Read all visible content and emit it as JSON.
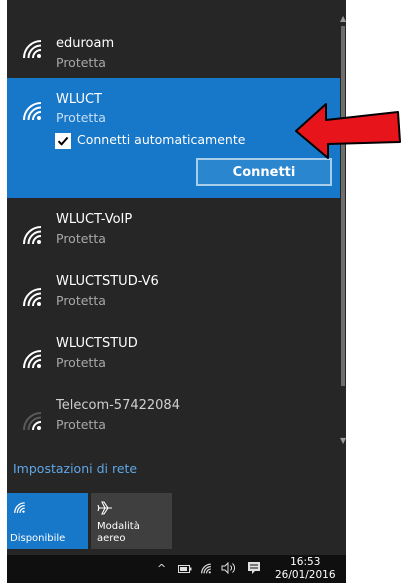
{
  "networks": [
    {
      "name": "eduroam",
      "status": "Protetta"
    },
    {
      "name": "WLUCT",
      "status": "Protetta"
    },
    {
      "name": "WLUCT-VoIP",
      "status": "Protetta"
    },
    {
      "name": "WLUCTSTUD-V6",
      "status": "Protetta"
    },
    {
      "name": "WLUCTSTUD",
      "status": "Protetta"
    },
    {
      "name": "Telecom-57422084",
      "status": "Protetta"
    }
  ],
  "selected": {
    "auto_connect_label": "Connetti automaticamente",
    "auto_connect_checked": true,
    "connect_label": "Connetti"
  },
  "settings_link": "Impostazioni di rete",
  "tiles": [
    {
      "label": "Disponibile",
      "icon": "wifi-icon",
      "active": true
    },
    {
      "label_line1": "Modalità",
      "label_line2": "aereo",
      "icon": "airplane-icon",
      "active": false
    }
  ],
  "taskbar": {
    "time": "16:53",
    "date": "26/01/2016",
    "icons": [
      "chevron-up-icon",
      "battery-icon",
      "wifi-icon",
      "volume-icon",
      "notification-icon"
    ]
  },
  "colors": {
    "flyout_bg": "#262626",
    "accent": "#1777c9",
    "link": "#5fa7e6",
    "annotation_arrow": "#e8141b"
  }
}
